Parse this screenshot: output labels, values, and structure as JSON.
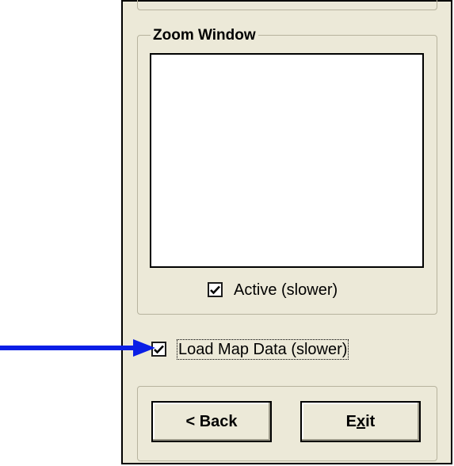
{
  "zoom_window": {
    "title": "Zoom Window",
    "active_checkbox": {
      "label": "Active (slower)",
      "checked": true
    }
  },
  "load_map_checkbox": {
    "label": "Load Map Data (slower)",
    "checked": true
  },
  "buttons": {
    "back_label": "< Back",
    "exit_label": "Exit"
  },
  "colors": {
    "panel_background": "#ece9d8",
    "arrow": "#0a1ee6",
    "group_border": "#b7b39e"
  },
  "icons": {
    "checkmark": "checkmark-icon",
    "arrow": "arrow-right-icon"
  }
}
